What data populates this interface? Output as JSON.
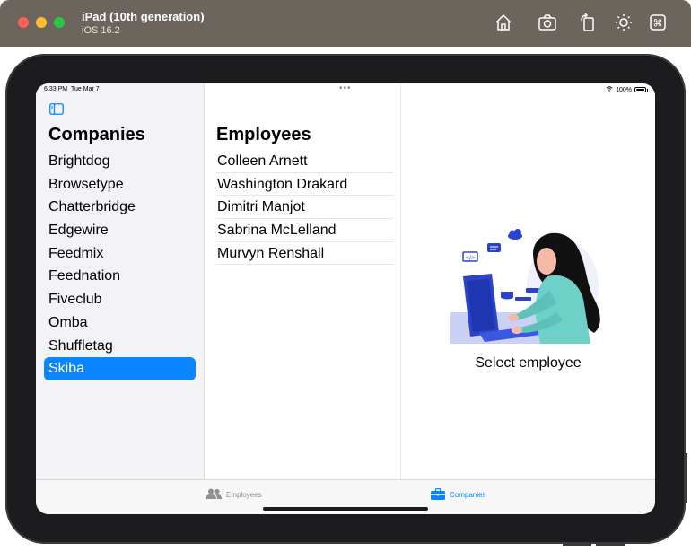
{
  "window": {
    "title": "iPad (10th generation)",
    "subtitle": "iOS 16.2",
    "toolbar_icons": [
      "home-icon",
      "screenshot-icon",
      "rotate-icon",
      "appearance-icon",
      "command-icon"
    ]
  },
  "status_bar": {
    "time": "6:33 PM",
    "date": "Tue Mar 7",
    "multitask_dots": "•••",
    "battery": "100%"
  },
  "companies": {
    "title": "Companies",
    "items": [
      "Brightdog",
      "Browsetype",
      "Chatterbridge",
      "Edgewire",
      "Feedmix",
      "Feednation",
      "Fiveclub",
      "Omba",
      "Shuffletag",
      "Skiba"
    ],
    "selected": "Skiba"
  },
  "employees": {
    "title": "Employees",
    "items": [
      "Colleen Arnett",
      "Washington Drakard",
      "Dimitri Manjot",
      "Sabrina McLelland",
      "Murvyn Renshall"
    ]
  },
  "detail": {
    "placeholder": "Select employee"
  },
  "tabbar": {
    "tabs": [
      {
        "label": "Employees",
        "icon": "people-icon",
        "active": false
      },
      {
        "label": "Companies",
        "icon": "briefcase-icon",
        "active": true
      }
    ]
  },
  "colors": {
    "accent": "#0a84ff",
    "sidebar_bg": "#f2f2f7",
    "titlebar": "#6b655e"
  }
}
